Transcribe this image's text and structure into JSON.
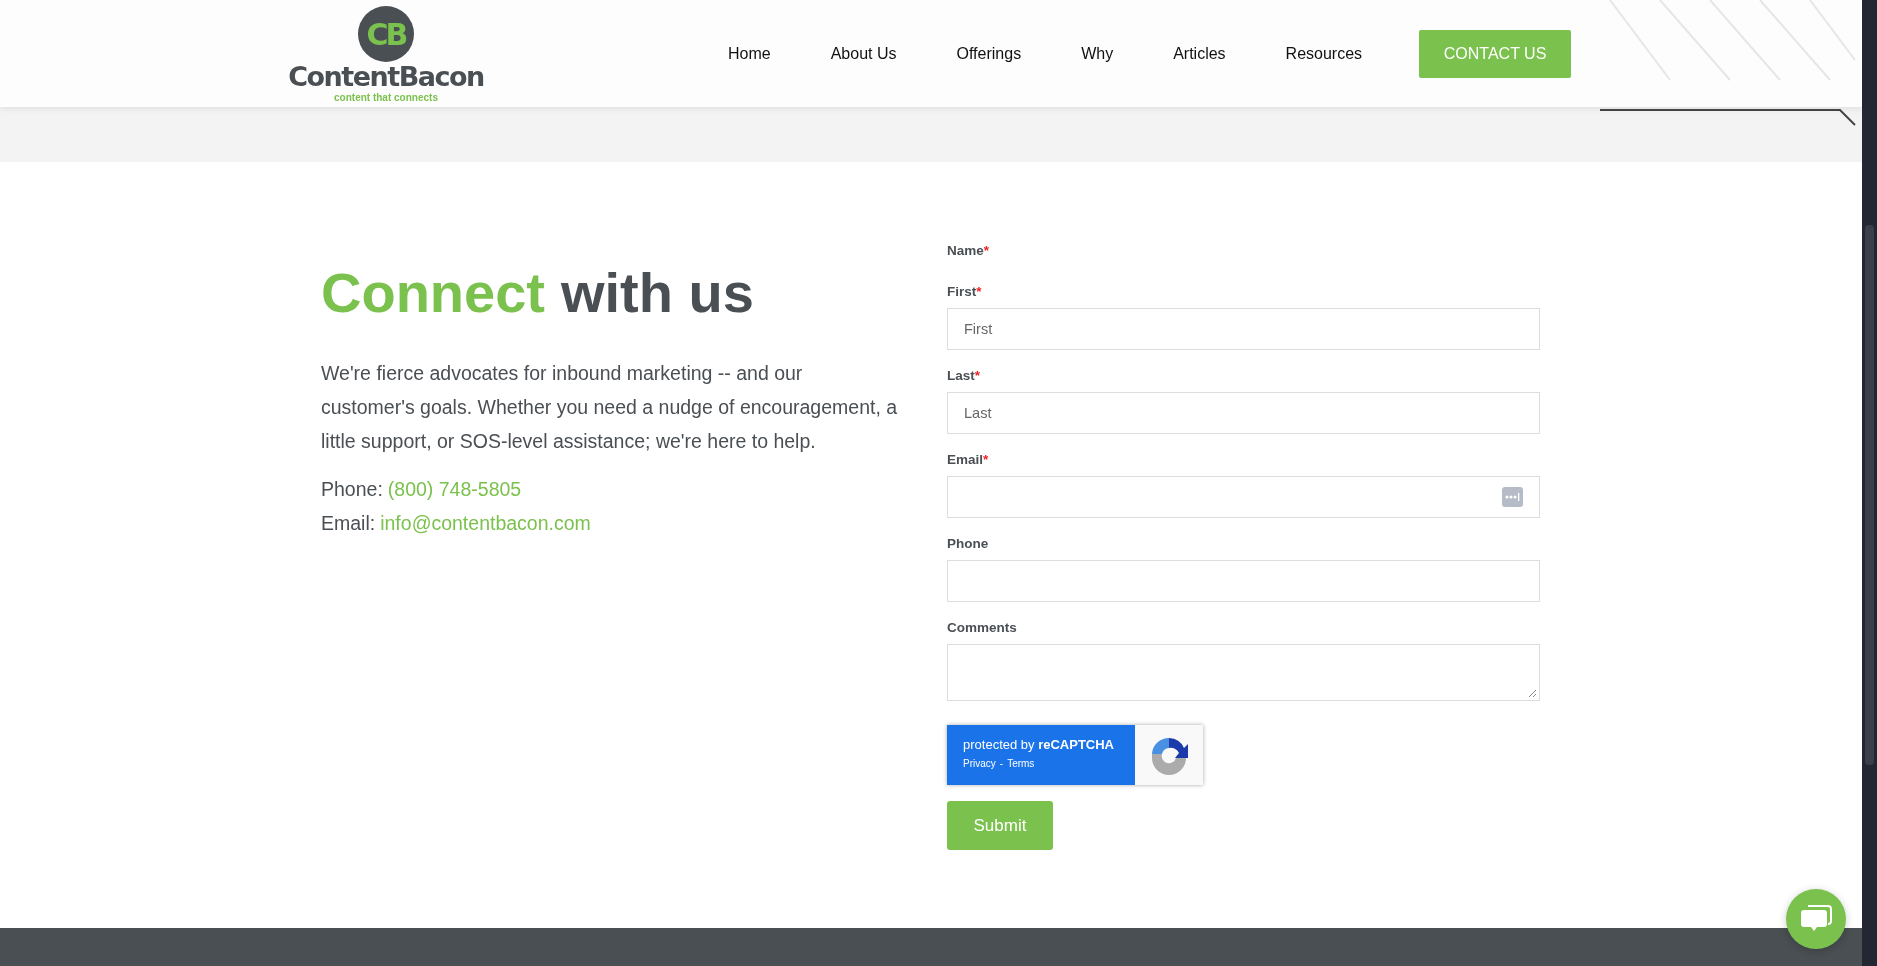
{
  "header": {
    "logo": {
      "monogram": "CB",
      "name": "ContentBacon",
      "tagline": "content that connects"
    },
    "nav": [
      {
        "label": "Home"
      },
      {
        "label": "About Us"
      },
      {
        "label": "Offerings"
      },
      {
        "label": "Why"
      },
      {
        "label": "Articles"
      },
      {
        "label": "Resources"
      }
    ],
    "contact_button": "CONTACT US"
  },
  "intro": {
    "heading_accent": "Connect",
    "heading_rest": "with us",
    "paragraph": "We're fierce advocates for inbound marketing -- and our customer's goals. Whether you need a nudge of encouragement, a little support, or SOS-level assistance; we're here to help.",
    "contacts": [
      {
        "label": "Phone:",
        "value": "(800) 748-5805"
      },
      {
        "label": "Email:",
        "value": "info@contentbacon.com"
      }
    ]
  },
  "form": {
    "fields": [
      {
        "kind": "group",
        "label": "Name",
        "required": true
      },
      {
        "kind": "text",
        "label": "First",
        "required": true,
        "placeholder": "First",
        "autofill": false
      },
      {
        "kind": "text",
        "label": "Last",
        "required": true,
        "placeholder": "Last",
        "autofill": false
      },
      {
        "kind": "text",
        "label": "Email",
        "required": true,
        "autofill": true
      },
      {
        "kind": "text",
        "label": "Phone",
        "required": false,
        "autofill": false
      },
      {
        "kind": "textarea",
        "label": "Comments",
        "required": false
      }
    ],
    "required_mark": "*",
    "recaptcha": {
      "text": "protected by **reCAPTCHA**",
      "links": [
        "Privacy",
        "Terms"
      ],
      "separator": "-"
    },
    "submit": "Submit"
  }
}
